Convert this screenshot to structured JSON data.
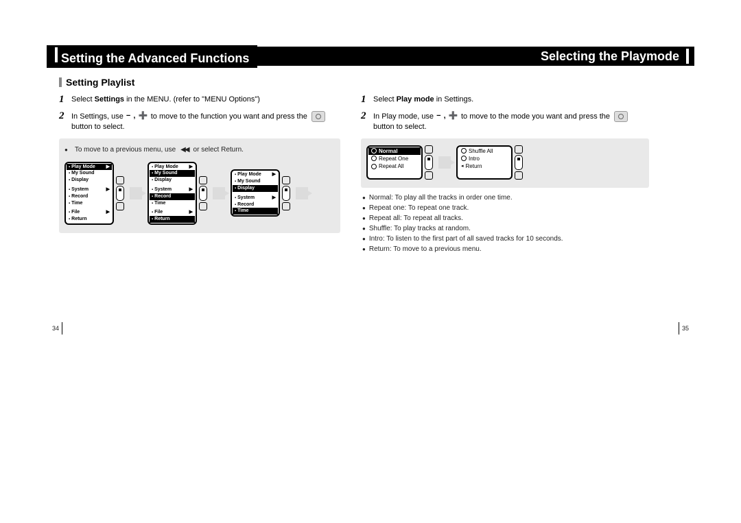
{
  "header": {
    "left_title": "Setting the Advanced Functions",
    "right_title": "Selecting the Playmode"
  },
  "section_title": "Setting Playlist",
  "left": {
    "step1_pre": "Select ",
    "step1_bold": "Settings",
    "step1_post": " in the MENU. (refer to \"MENU Options\")",
    "step2_pre": "In Settings, use ",
    "step2_pm": "− , ➕",
    "step2_post": " to move to the function you want and press the ",
    "step2_tail": " button to select.",
    "note_pre": "To move to a previous menu, use ",
    "note_mid": "◀◀",
    "note_post": " or select Return.",
    "screens": [
      {
        "blocks": [
          {
            "items": [
              {
                "label": "Play Mode",
                "hl": true,
                "arrow": true
              },
              {
                "label": "My Sound",
                "arrow": false
              },
              {
                "label": "Display",
                "arrow": false
              }
            ]
          },
          {
            "items": [
              {
                "label": "System",
                "hl": false,
                "arrow": true
              },
              {
                "label": "Record",
                "arrow": false
              },
              {
                "label": "Time",
                "arrow": false
              }
            ]
          },
          {
            "items": [
              {
                "label": "File",
                "hl": false,
                "arrow": true
              },
              {
                "label": "Return",
                "arrow": false
              }
            ]
          }
        ]
      },
      {
        "blocks": [
          {
            "items": [
              {
                "label": "Play Mode",
                "arrow": true
              },
              {
                "label": "My Sound",
                "hl": true,
                "arrow": false
              },
              {
                "label": "Display",
                "arrow": false
              }
            ]
          },
          {
            "items": [
              {
                "label": "System",
                "arrow": true
              },
              {
                "label": "Record",
                "hl": true,
                "arrow": false
              },
              {
                "label": "Time",
                "arrow": false
              }
            ]
          },
          {
            "items": [
              {
                "label": "File",
                "arrow": true
              },
              {
                "label": "Return",
                "hl": true,
                "arrow": false
              }
            ]
          }
        ]
      },
      {
        "blocks": [
          {
            "items": [
              {
                "label": "Play Mode",
                "arrow": true
              },
              {
                "label": "My Sound",
                "arrow": false
              },
              {
                "label": "Display",
                "hl": true,
                "arrow": false
              }
            ]
          },
          {
            "items": [
              {
                "label": "System",
                "arrow": true
              },
              {
                "label": "Record",
                "arrow": false
              },
              {
                "label": "Time",
                "hl": true,
                "arrow": false
              }
            ]
          }
        ]
      }
    ]
  },
  "right": {
    "step1_pre": "Select ",
    "step1_bold": "Play mode",
    "step1_post": " in Settings.",
    "step2_pre": "In Play mode, use ",
    "step2_pm": "− , ➕",
    "step2_post": " to move to the mode you want and press the ",
    "step2_tail": " button to select.",
    "play_screen": {
      "left_col": [
        {
          "label": "Normal",
          "hl": true,
          "radio": true
        },
        {
          "label": "Repeat One",
          "radio": false
        },
        {
          "label": "Repeat All",
          "radio": false
        }
      ],
      "right_col": [
        {
          "label": "Shuffle All",
          "radio": false
        },
        {
          "label": "Intro",
          "radio": false
        },
        {
          "label": "Return",
          "arrow": true
        }
      ]
    },
    "descriptions": [
      "Normal: To play all the tracks in order one time.",
      "Repeat one: To repeat one track.",
      "Repeat all: To repeat all tracks.",
      "Shuffle: To play tracks at random.",
      "Intro: To listen to the first part of all saved tracks for 10 seconds.",
      "Return: To move to a previous menu."
    ]
  },
  "page_numbers": {
    "left": "34",
    "right": "35"
  }
}
